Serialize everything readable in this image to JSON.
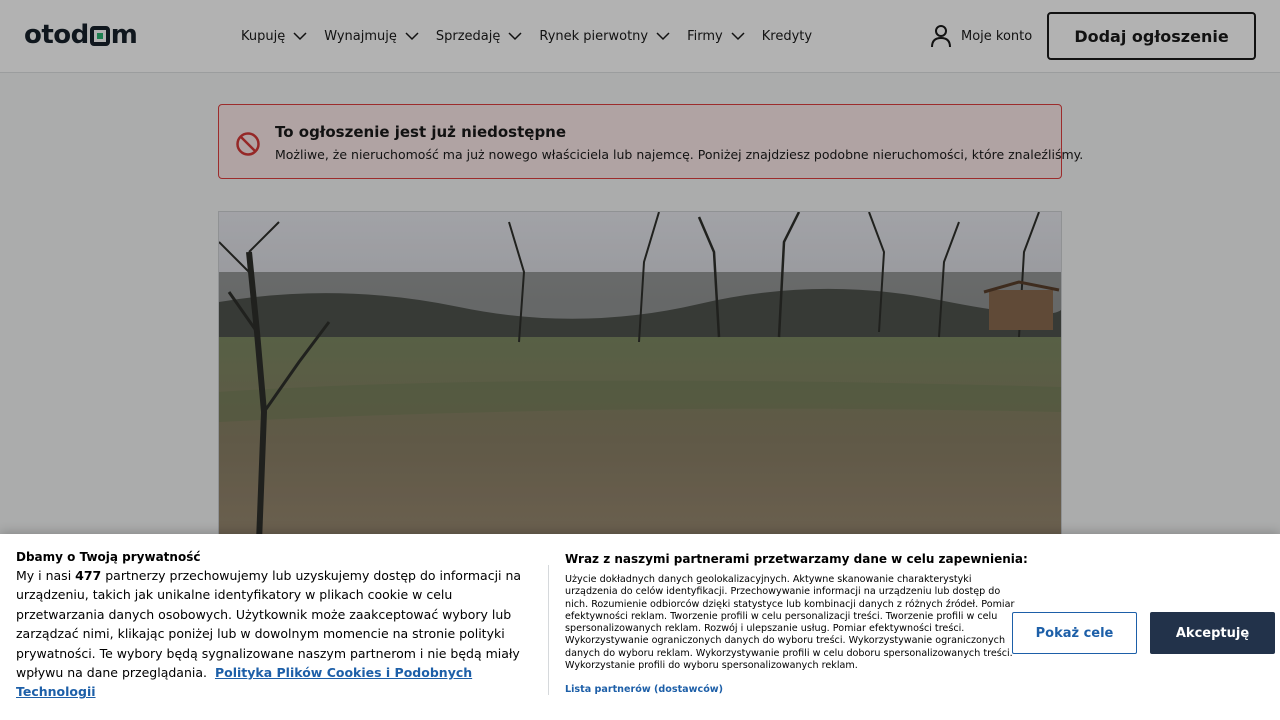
{
  "brand": {
    "logo_prefix": "otod",
    "logo_suffix": "m",
    "accent": "#2bb673",
    "dark": "#17212b"
  },
  "nav": {
    "items": [
      {
        "label": "Kupuję",
        "dropdown": true
      },
      {
        "label": "Wynajmuję",
        "dropdown": true
      },
      {
        "label": "Sprzedaję",
        "dropdown": true
      },
      {
        "label": "Rynek pierwotny",
        "dropdown": true
      },
      {
        "label": "Firmy",
        "dropdown": true
      },
      {
        "label": "Kredyty",
        "dropdown": false
      }
    ],
    "account_label": "Moje konto",
    "add_listing_label": "Dodaj ogłoszenie"
  },
  "alert": {
    "title": "To ogłoszenie jest już niedostępne",
    "text": "Możliwe, że nieruchomość ma już nowego właściciela lub najemcę. Poniżej znajdziesz podobne nieruchomości, które znaleźliśmy.",
    "color": "#e0403f",
    "icon": "blocked-icon"
  },
  "photo": {
    "subject": "listing-photo"
  },
  "consent": {
    "title": "Dbamy o Twoją prywatność",
    "body_before": "My i nasi ",
    "partner_count": "477",
    "body_after": " partnerzy przechowujemy lub uzyskujemy dostęp do informacji na urządzeniu, takich jak unikalne identyfikatory w plikach cookie w celu przetwarzania danych osobowych. Użytkownik może zaakceptować wybory lub zarządzać nimi, klikając poniżej lub w dowolnym momencie na stronie polityki prywatności. Te wybory będą sygnalizowane naszym partnerom i nie będą miały wpływu na dane przeglądania.",
    "policy_link": "Polityka Plików Cookies i Podobnych Technologii",
    "right_title": "Wraz z naszymi partnerami przetwarzamy dane w celu zapewnienia:",
    "purposes": "Użycie dokładnych danych geolokalizacyjnych. Aktywne skanowanie charakterystyki urządzenia do celów identyfikacji. Przechowywanie informacji na urządzeniu lub dostęp do nich. Rozumienie odbiorców dzięki statystyce lub kombinacji danych z różnych źródeł. Pomiar efektywności reklam. Tworzenie profili w celu personalizacji treści. Tworzenie profili w celu spersonalizowanych reklam. Rozwój i ulepszanie usług. Pomiar efektywności treści. Wykorzystywanie ograniczonych danych do wyboru treści. Wykorzystywanie ograniczonych danych do wyboru reklam. Wykorzystywanie profili w celu doboru spersonalizowanych treści. Wykorzystanie profili do wyboru spersonalizowanych reklam.",
    "partners_link": "Lista partnerów (dostawców)",
    "show_purposes_label": "Pokaż cele",
    "accept_label": "Akceptuję",
    "link_color": "#1d5fa8",
    "accept_color": "#22324a"
  }
}
